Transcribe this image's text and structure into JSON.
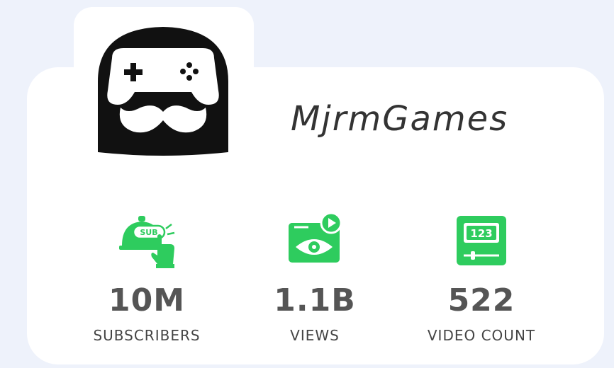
{
  "channel": {
    "name": "MjrmGames",
    "logo_icon": "gamer-mustache-logo-icon"
  },
  "stats": {
    "subscribers": {
      "value": "10M",
      "label": "SUBSCRIBERS",
      "icon": "subscribe-bell-icon"
    },
    "views": {
      "value": "1.1B",
      "label": "VIEWS",
      "icon": "video-views-eye-icon"
    },
    "video_count": {
      "value": "522",
      "label": "VIDEO COUNT",
      "icon": "video-counter-icon",
      "icon_text": "123"
    }
  },
  "colors": {
    "background": "#eef2fb",
    "card": "#ffffff",
    "accent_green": "#2ecc5e",
    "value_text": "#555555",
    "label_text": "#444444",
    "logo": "#111111"
  }
}
